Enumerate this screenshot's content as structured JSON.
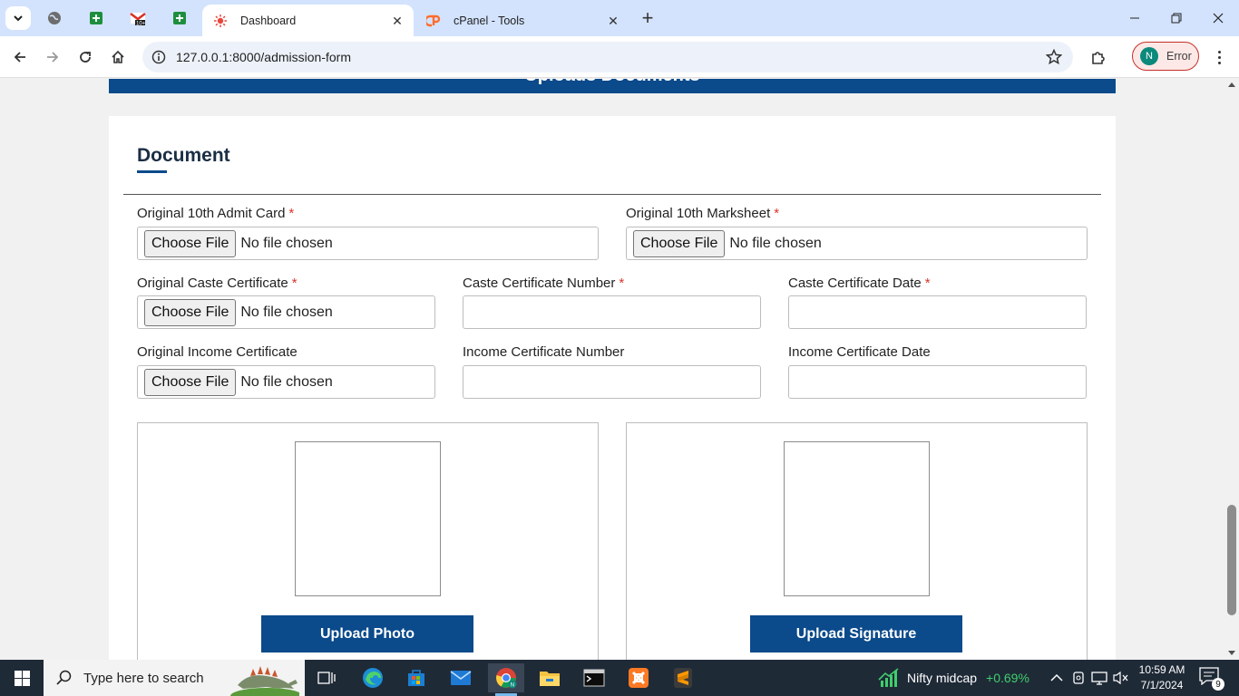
{
  "browser": {
    "tabs": [
      {
        "title": "Dashboard",
        "active": true
      },
      {
        "title": "cPanel - Tools",
        "active": false
      }
    ],
    "url": "127.0.0.1:8000/admission-form",
    "profile_status": "Error",
    "profile_initial": "N"
  },
  "page": {
    "banner_title": "Uploads Documents",
    "section_title": "Document",
    "required_mark": "*",
    "choose_file_label": "Choose File",
    "no_file_text": "No file chosen",
    "fields": {
      "admit_card": {
        "label": "Original 10th Admit Card",
        "required": true
      },
      "marksheet": {
        "label": "Original 10th Marksheet",
        "required": true
      },
      "caste_certificate": {
        "label": "Original Caste Certificate",
        "required": true
      },
      "caste_number": {
        "label": "Caste Certificate Number",
        "required": true,
        "value": ""
      },
      "caste_date": {
        "label": "Caste Certificate Date",
        "required": true,
        "value": ""
      },
      "income_certificate": {
        "label": "Original Income Certificate",
        "required": false
      },
      "income_number": {
        "label": "Income Certificate Number",
        "required": false,
        "value": ""
      },
      "income_date": {
        "label": "Income Certificate Date",
        "required": false,
        "value": ""
      }
    },
    "upload_photo_label": "Upload Photo",
    "upload_signature_label": "Upload Signature",
    "accent_color": "#0b4a8b",
    "required_color": "#d9342b"
  },
  "taskbar": {
    "search_placeholder": "Type here to search",
    "stock_name": "Nifty midcap",
    "stock_change": "+0.69%",
    "time": "10:59 AM",
    "date": "7/1/2024",
    "notification_count": "9",
    "apps": [
      "task-view",
      "edge",
      "microsoft-store",
      "mail",
      "chrome",
      "file-explorer",
      "terminal",
      "xampp",
      "sublime-text"
    ]
  }
}
